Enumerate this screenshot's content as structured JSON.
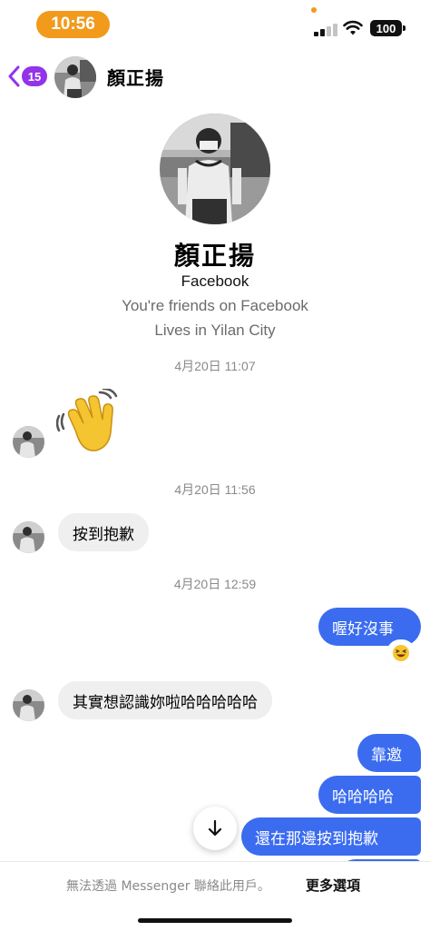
{
  "status_bar": {
    "time": "10:56",
    "battery": "100"
  },
  "header": {
    "back_count": "15",
    "contact_name": "顏正揚"
  },
  "profile": {
    "name": "顏正揚",
    "source": "Facebook",
    "friends_text": "You're friends on Facebook",
    "location_text": "Lives in Yilan City"
  },
  "messages": {
    "ts1": "4月20日 11:07",
    "ts2": "4月20日 11:56",
    "ts3": "4月20日 12:59",
    "in1": "按到抱歉",
    "out1": "喔好沒事",
    "in2": "其實想認識妳啦哈哈哈哈哈",
    "out2": "靠邀",
    "out3": "哈哈哈哈",
    "out4": "還在那邊按到抱歉"
  },
  "bottom": {
    "notice": "無法透過 Messenger 聯絡此用戶。",
    "more": "更多選項"
  },
  "colors": {
    "accent_orange": "#f19a1c",
    "badge_purple": "#9333ea",
    "outgoing_bubble": "#3b6cf0",
    "incoming_bubble": "#efefef"
  },
  "icons": [
    "back-chevron-icon",
    "wave-emoji-icon",
    "laughing-emoji-icon",
    "arrow-down-icon",
    "wifi-icon",
    "signal-icon"
  ]
}
